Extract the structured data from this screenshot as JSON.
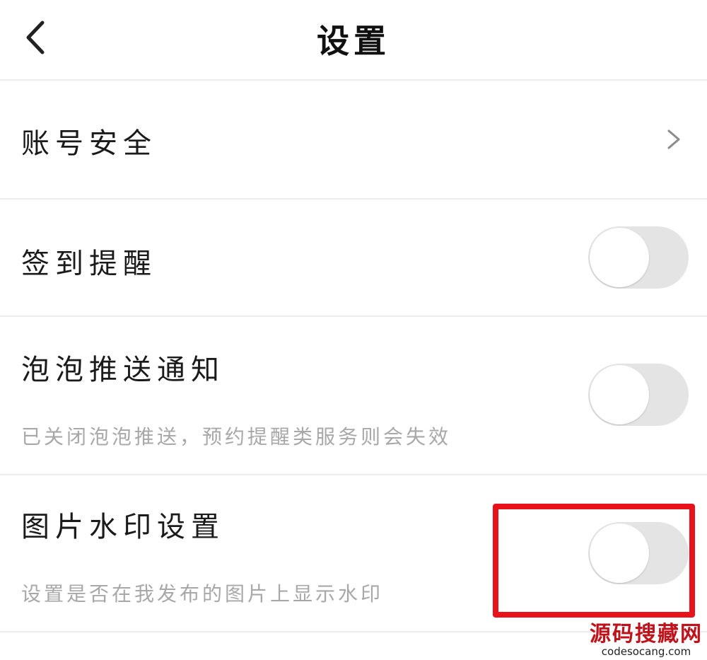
{
  "header": {
    "title": "设置",
    "back_icon": "chevron-left-icon"
  },
  "settings": {
    "account_security": {
      "label": "账号安全",
      "icon": "chevron-right-icon"
    },
    "checkin_reminder": {
      "label": "签到提醒",
      "enabled": false
    },
    "bubble_push": {
      "label": "泡泡推送通知",
      "description": "已关闭泡泡推送，预约提醒类服务则会失效",
      "enabled": false
    },
    "image_watermark": {
      "label": "图片水印设置",
      "description": "设置是否在我发布的图片上显示水印",
      "enabled": false
    }
  },
  "annotation": {
    "highlight_color": "#e8121b",
    "highlight_target": "image-watermark-toggle"
  },
  "watermark": {
    "text_cn": "源码搜藏网",
    "text_en": "codesocang.com"
  },
  "colors": {
    "toggle_off_track": "#e4e4e4",
    "knob": "#ffffff",
    "divider": "#ececec",
    "secondary_text": "#a8a8a8"
  }
}
